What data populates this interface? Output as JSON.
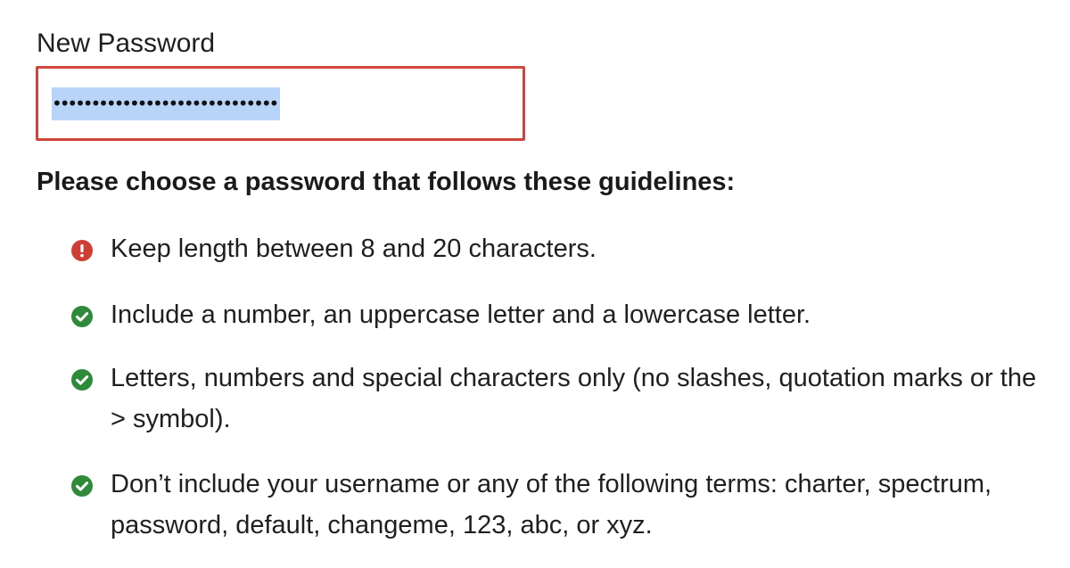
{
  "form": {
    "new_password_label": "New Password",
    "password_value": "•••••••••••••••••••••••••••••"
  },
  "guidelines": {
    "heading": "Please choose a password that follows these guidelines:",
    "rules": [
      {
        "status": "error",
        "icon": "exclamation-icon",
        "text": "Keep length between 8 and 20 characters."
      },
      {
        "status": "ok",
        "icon": "checkmark-icon",
        "text": "Include a number, an uppercase letter and a lowercase letter."
      },
      {
        "status": "ok",
        "icon": "checkmark-icon",
        "text": "Letters, numbers and special characters only (no slashes, quotation marks or the > symbol)."
      },
      {
        "status": "ok",
        "icon": "checkmark-icon",
        "text": "Don’t include your username or any of the following terms: charter, spectrum, password, default, changeme, 123, abc, or xyz."
      }
    ]
  },
  "colors": {
    "error": "#cf3e34",
    "ok": "#2f8a3a",
    "selection": "#b8d4f8",
    "input_border_error": "#d0463a"
  }
}
